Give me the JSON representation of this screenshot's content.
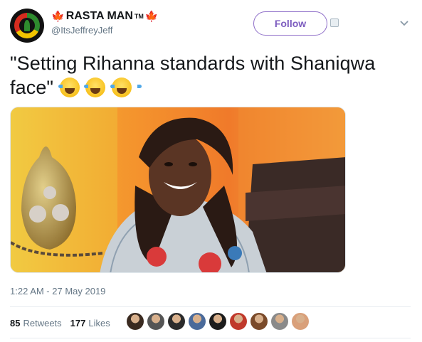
{
  "tweet": {
    "display_name": "RASTA MAN",
    "trademark": "TM",
    "handle": "@ItsJeffreyJeff",
    "follow_label": "Follow",
    "text": "\"Setting Rihanna standards with Shaniqwa face\"",
    "emojis": [
      "face-with-tears-of-joy",
      "face-with-tears-of-joy",
      "face-with-tears-of-joy"
    ],
    "timestamp": "1:22 AM - 27 May 2019",
    "retweets_count": "85",
    "retweets_label": "Retweets",
    "likes_count": "177",
    "likes_label": "Likes"
  },
  "icons": {
    "flag_left": "maple-leaf-icon",
    "flag_right": "maple-leaf-icon",
    "menu": "chevron-down-icon"
  },
  "colors": {
    "follow_border": "#8e6ec8",
    "follow_text": "#7c5cbf",
    "maple": "#d8232a",
    "muted": "#657786"
  },
  "likers": [
    "#3a2a20",
    "#555555",
    "#2b2b2b",
    "#4a6a9a",
    "#1c1c1c",
    "#c0392b",
    "#7a4a2a",
    "#8a8a8a",
    "#d9a07a"
  ]
}
